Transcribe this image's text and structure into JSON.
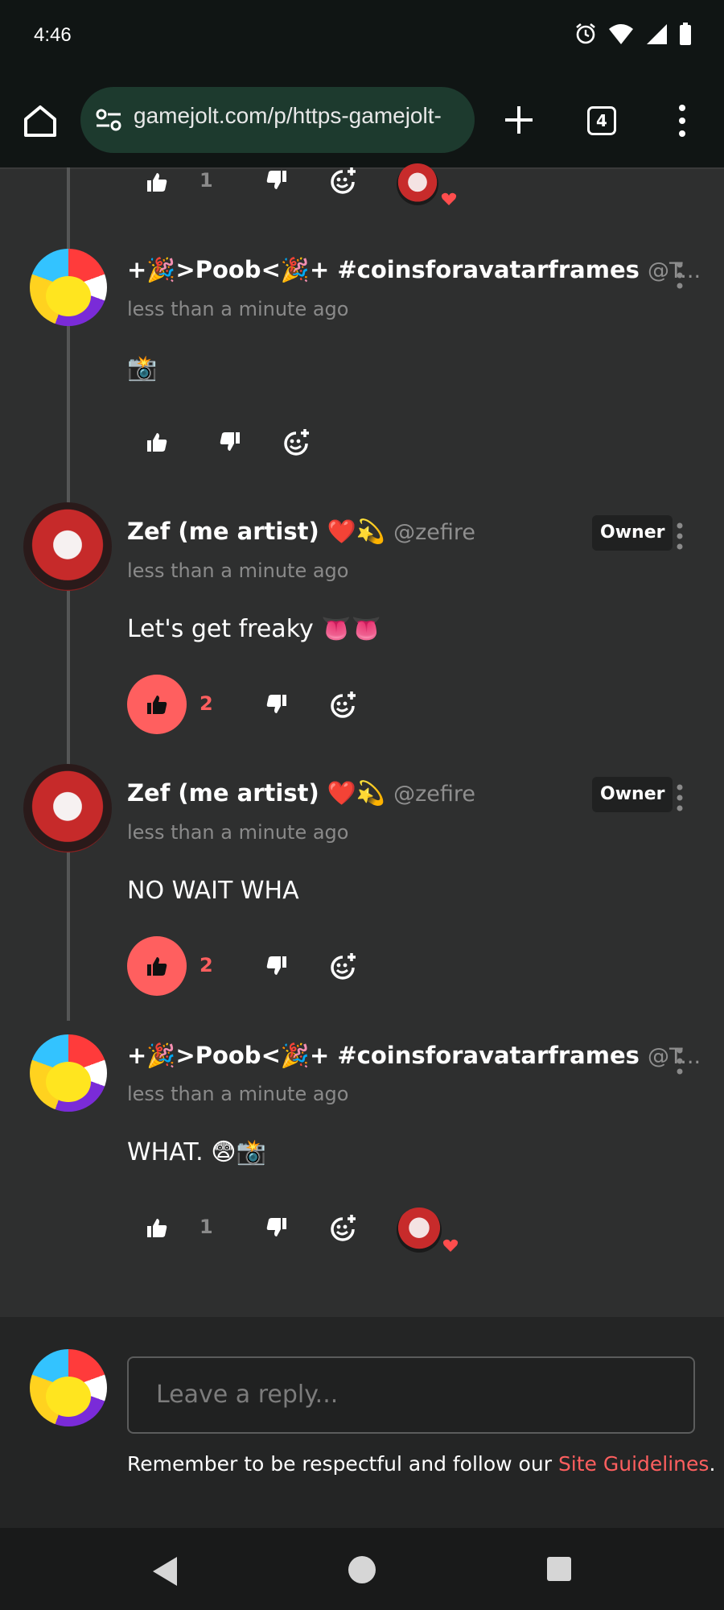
{
  "status_bar": {
    "time": "4:46"
  },
  "browser": {
    "url": "gamejolt.com/p/https-gamejolt-",
    "tab_count": "4"
  },
  "top_partial": {
    "like_count": "1"
  },
  "comments": [
    {
      "name": "+🎉>Poob<🎉+ #coinsforavatarframes",
      "handle": "@T...",
      "time": "less than a minute ago",
      "body": "📸",
      "like_count": "",
      "liked": false
    },
    {
      "name": "Zef (me artist) ❤️💫",
      "handle": "@zefire",
      "badge": "Owner",
      "time": "less than a minute ago",
      "body": "Let's get freaky 👅👅",
      "like_count": "2",
      "liked": true
    },
    {
      "name": "Zef (me artist) ❤️💫",
      "handle": "@zefire",
      "badge": "Owner",
      "time": "less than a minute ago",
      "body": "NO WAIT WHA",
      "like_count": "2",
      "liked": true
    },
    {
      "name": "+🎉>Poob<🎉+ #coinsforavatarframes",
      "handle": "@T...",
      "time": "less than a minute ago",
      "body": "WHAT. 😨📸",
      "like_count": "1",
      "liked": false
    }
  ],
  "reply": {
    "placeholder": "Leave a reply...",
    "note_prefix": "Remember to be respectful and follow our ",
    "note_link": "Site Guidelines",
    "note_suffix": "."
  },
  "colors": {
    "accent": "#ff5f5f",
    "background": "#2e2f2f",
    "toolbar": "#101514",
    "url_box": "#1d3a2e"
  }
}
